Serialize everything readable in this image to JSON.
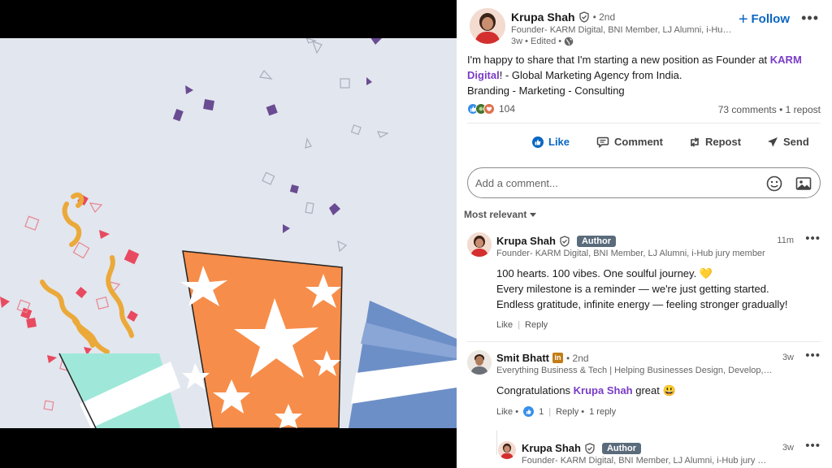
{
  "post": {
    "author_name": "Krupa Shah",
    "degree": "• 2nd",
    "headline": "Founder- KARM Digital, BNI Member, LJ Alumni, i-Hub jury member",
    "meta": "3w • Edited •",
    "follow_label": "Follow",
    "more_label": "•••",
    "text_line1_pre": "I'm happy to share that I'm starting a new position as Founder at ",
    "text_company": "KARM Digital",
    "text_line1_post": "! - Global Marketing Agency from India.",
    "text_line2": "Branding - Marketing - Consulting",
    "reaction_count": "104",
    "comments_reposts": "73 comments • 1 repost"
  },
  "actions": {
    "like": "Like",
    "comment": "Comment",
    "repost": "Repost",
    "send": "Send"
  },
  "comment_box": {
    "placeholder": "Add a comment..."
  },
  "sort_label": "Most relevant",
  "comments": [
    {
      "name": "Krupa Shah",
      "badge": "Author",
      "headline": "Founder- KARM Digital, BNI Member, LJ Alumni, i-Hub jury member",
      "time": "11m",
      "line1": "100 hearts. 100 vibes. One soulful journey. 💛",
      "line2": "Every milestone is a reminder — we're just getting started.",
      "line3": "Endless gratitude, infinite energy — feeling stronger gradually!",
      "like": "Like",
      "reply": "Reply"
    },
    {
      "name": "Smit Bhatt",
      "degree": "• 2nd",
      "headline": "Everything Business & Tech | Helping Businesses Design, Develop, Automate & Scale",
      "time": "3w",
      "text_pre": "Congratulations ",
      "mention": "Krupa Shah",
      "text_post": " great 😃",
      "like": "Like •",
      "like_count": "1",
      "reply": "Reply •",
      "replies": "1 reply"
    },
    {
      "name": "Krupa Shah",
      "badge": "Author",
      "headline": "Founder- KARM Digital, BNI Member, LJ Alumni, i-Hub jury member",
      "time": "3w"
    }
  ],
  "colors": {
    "link_blue": "#0a66c2",
    "mention_purple": "#7a3cc5",
    "author_badge": "#5a6b7b",
    "image_bg": "#e2e6ee",
    "confetti_purple": "#6a4c93",
    "confetti_red": "#e84a5f",
    "ribbon_yellow": "#eba93a",
    "box_orange": "#f78d4a",
    "box_blue": "#6d8fc7",
    "box_teal": "#9fe8d9"
  }
}
